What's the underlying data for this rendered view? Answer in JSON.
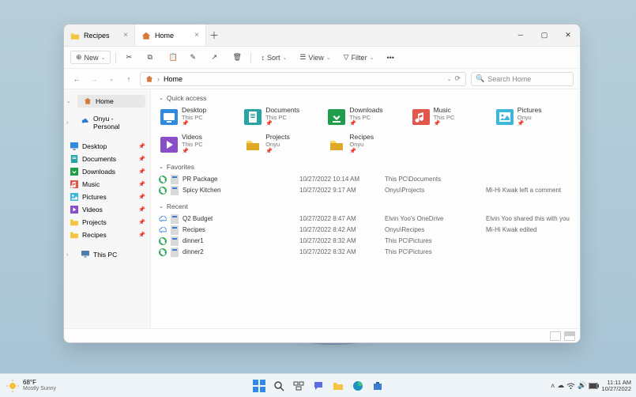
{
  "tabs": [
    {
      "label": "Recipes",
      "active": false
    },
    {
      "label": "Home",
      "active": true
    }
  ],
  "toolbar": {
    "new": "New",
    "view": "View",
    "filter": "Filter"
  },
  "address": {
    "label": "Home",
    "search_placeholder": "Search Home"
  },
  "sidebar": {
    "home": "Home",
    "onyu": "Onyu - Personal",
    "items": [
      {
        "label": "Desktop"
      },
      {
        "label": "Documents"
      },
      {
        "label": "Downloads"
      },
      {
        "label": "Music"
      },
      {
        "label": "Pictures"
      },
      {
        "label": "Videos"
      },
      {
        "label": "Projects"
      },
      {
        "label": "Recipes"
      }
    ],
    "thispc": "This PC"
  },
  "sections": {
    "quick": "Quick access",
    "favorites": "Favorites",
    "recent": "Recent"
  },
  "quick": [
    {
      "name": "Desktop",
      "sub": "This PC",
      "color": "#2f8ae0",
      "glyph": "desktop"
    },
    {
      "name": "Documents",
      "sub": "This PC",
      "color": "#2aa3a6",
      "glyph": "doc"
    },
    {
      "name": "Downloads",
      "sub": "This PC",
      "color": "#1f9c4c",
      "glyph": "down"
    },
    {
      "name": "Music",
      "sub": "This PC",
      "color": "#e2574c",
      "glyph": "music"
    },
    {
      "name": "Pictures",
      "sub": "Onyu",
      "color": "#3fb7d8",
      "glyph": "pic"
    },
    {
      "name": "Videos",
      "sub": "This PC",
      "color": "#8a4ec9",
      "glyph": "vid"
    },
    {
      "name": "Projects",
      "sub": "Onyu",
      "color": "#f5c542",
      "glyph": "folder"
    },
    {
      "name": "Recipes",
      "sub": "Onyu",
      "color": "#f5c542",
      "glyph": "folder"
    }
  ],
  "favorites": [
    {
      "name": "PR Package",
      "date": "10/27/2022 10:14 AM",
      "loc": "This PC\\Documents",
      "note": ""
    },
    {
      "name": "Spicy Kitchen",
      "date": "10/27/2022 9:17 AM",
      "loc": "Onyu\\Projects",
      "note": "Mi-Hi Kwak left a comment"
    }
  ],
  "recent": [
    {
      "name": "Q2 Budget",
      "date": "10/27/2022 8:47 AM",
      "loc": "Elvin Yoo's OneDrive",
      "note": "Elvin Yoo shared this with you"
    },
    {
      "name": "Recipes",
      "date": "10/27/2022 8:42 AM",
      "loc": "Onyu\\Recipes",
      "note": "Mi-Hi Kwak edited"
    },
    {
      "name": "dinner1",
      "date": "10/27/2022 8:32 AM",
      "loc": "This PC\\Pictures",
      "note": ""
    },
    {
      "name": "dinner2",
      "date": "10/27/2022 8:32 AM",
      "loc": "This PC\\Pictures",
      "note": ""
    }
  ],
  "taskbar": {
    "temp": "68°F",
    "weather": "Mostly Sunny",
    "time": "11:11 AM",
    "date": "10/27/2022"
  }
}
